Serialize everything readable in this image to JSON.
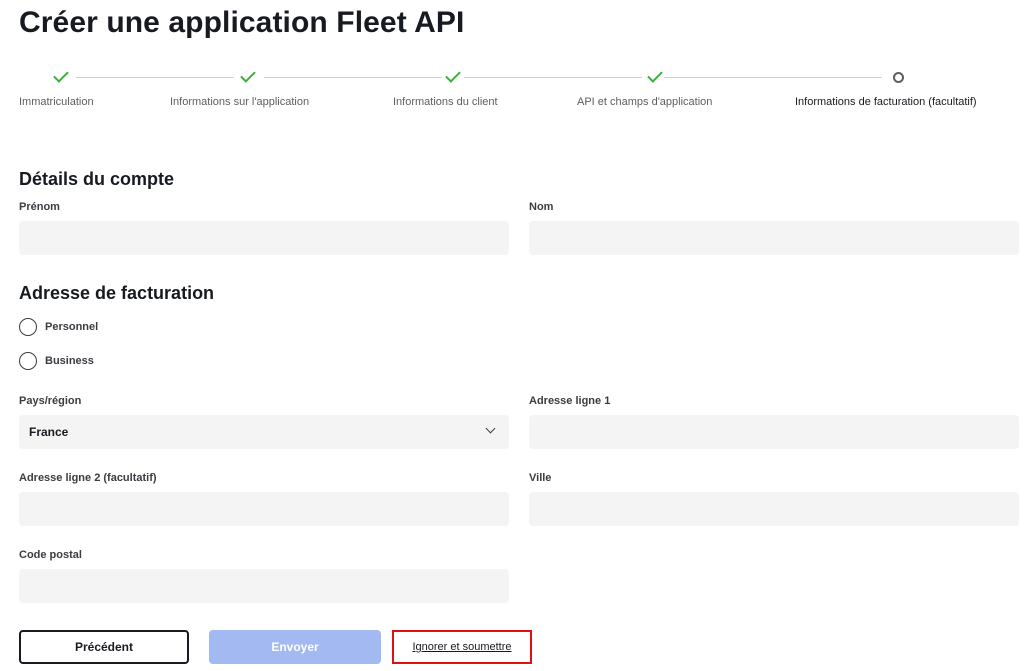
{
  "page_title": "Créer une application Fleet API",
  "stepper": {
    "steps": [
      {
        "label": "Immatriculation",
        "status": "done"
      },
      {
        "label": "Informations sur l'application",
        "status": "done"
      },
      {
        "label": "Informations du client",
        "status": "done"
      },
      {
        "label": "API et champs d'application",
        "status": "done"
      },
      {
        "label": "Informations de facturation (facultatif)",
        "status": "current"
      }
    ],
    "colors": {
      "done": "#3bb03b",
      "current": "#5c5e62"
    }
  },
  "account": {
    "heading": "Détails du compte",
    "first_name_label": "Prénom",
    "first_name_value": "",
    "last_name_label": "Nom",
    "last_name_value": ""
  },
  "billing": {
    "heading": "Adresse de facturation",
    "radio_options": [
      "Personnel",
      "Business"
    ],
    "country_label": "Pays/région",
    "country_value": "France",
    "address1_label": "Adresse ligne 1",
    "address1_value": "",
    "address2_label": "Adresse ligne 2 (facultatif)",
    "address2_value": "",
    "city_label": "Ville",
    "city_value": "",
    "postal_label": "Code postal",
    "postal_value": ""
  },
  "actions": {
    "previous_label": "Précédent",
    "submit_label": "Envoyer",
    "skip_label": "Ignorer et soumettre"
  },
  "colors": {
    "field_bg": "#f4f4f4",
    "submit_disabled": "#a2b9f2",
    "highlight": "#e01010"
  }
}
